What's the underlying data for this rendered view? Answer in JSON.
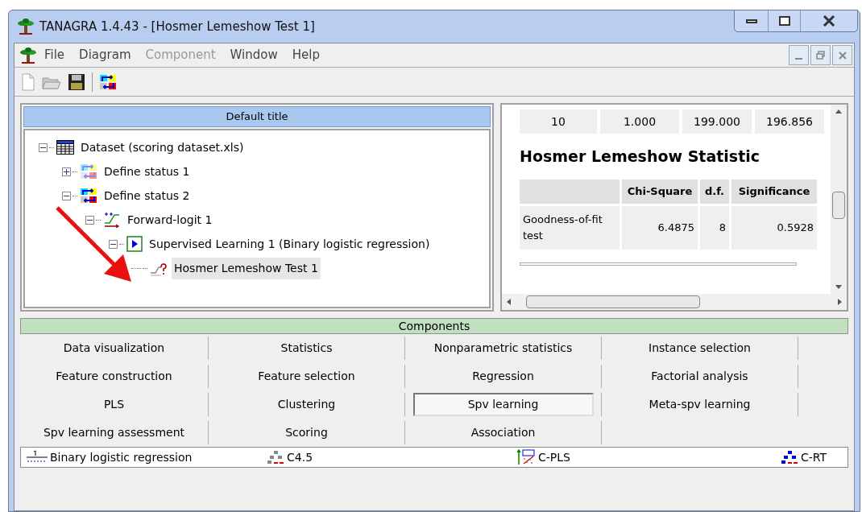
{
  "window": {
    "title": "TANAGRA 1.4.43 - [Hosmer Lemeshow Test 1]"
  },
  "menu": [
    {
      "label": "File",
      "disabled": false
    },
    {
      "label": "Diagram",
      "disabled": false
    },
    {
      "label": "Component",
      "disabled": true
    },
    {
      "label": "Window",
      "disabled": false
    },
    {
      "label": "Help",
      "disabled": false
    }
  ],
  "diagram": {
    "title": "Default title",
    "tree": [
      {
        "label": "Dataset (scoring dataset.xls)",
        "kind": "table",
        "expanded": true,
        "selected": false,
        "children": [
          {
            "label": "Define status 1",
            "kind": "status-faded",
            "expanded": false,
            "selected": false
          },
          {
            "label": "Define status 2",
            "kind": "status",
            "expanded": true,
            "selected": false,
            "children": [
              {
                "label": "Forward-logit 1",
                "kind": "logit",
                "expanded": true,
                "selected": false,
                "children": [
                  {
                    "label": "Supervised Learning 1 (Binary logistic regression)",
                    "kind": "play",
                    "expanded": true,
                    "selected": false,
                    "children": [
                      {
                        "label": "Hosmer Lemeshow Test 1",
                        "kind": "test",
                        "selected": true
                      }
                    ]
                  }
                ]
              }
            ]
          }
        ]
      }
    ]
  },
  "results": {
    "top_row": [
      "10",
      "1.000",
      "199.000",
      "196.856"
    ],
    "heading": "Hosmer Lemeshow Statistic",
    "table": {
      "columns": [
        "",
        "Chi-Square",
        "d.f.",
        "Significance"
      ],
      "rows": [
        [
          "Goodness-of-fit test",
          "6.4875",
          "8",
          "0.5928"
        ]
      ]
    }
  },
  "components": {
    "title": "Components",
    "categories": [
      {
        "label": "Data visualization",
        "selected": false
      },
      {
        "label": "Statistics",
        "selected": false
      },
      {
        "label": "Nonparametric statistics",
        "selected": false
      },
      {
        "label": "Instance selection",
        "selected": false
      },
      {
        "label": "Feature construction",
        "selected": false
      },
      {
        "label": "Feature selection",
        "selected": false
      },
      {
        "label": "Regression",
        "selected": false
      },
      {
        "label": "Factorial analysis",
        "selected": false
      },
      {
        "label": "PLS",
        "selected": false
      },
      {
        "label": "Clustering",
        "selected": false
      },
      {
        "label": "Spv learning",
        "selected": true
      },
      {
        "label": "Meta-spv learning",
        "selected": false
      },
      {
        "label": "Spv learning assessment",
        "selected": false
      },
      {
        "label": "Scoring",
        "selected": false
      },
      {
        "label": "Association",
        "selected": false
      }
    ],
    "items": [
      {
        "label": "Binary logistic regression",
        "kind": "fraction"
      },
      {
        "label": "C4.5",
        "kind": "tree-grey"
      },
      {
        "label": "C-PLS",
        "kind": "pls"
      },
      {
        "label": "C-RT",
        "kind": "tree-blue"
      }
    ]
  }
}
